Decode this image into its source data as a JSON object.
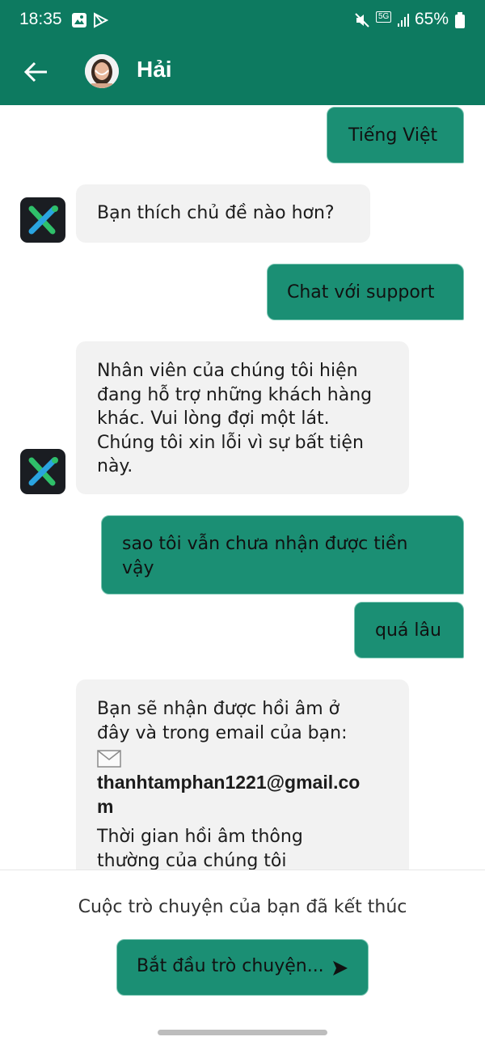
{
  "status_bar": {
    "time": "18:35",
    "battery_percent": "65%",
    "network": "5G"
  },
  "header": {
    "agent_name": "Hải"
  },
  "messages": [
    {
      "from": "user",
      "text": "Tiếng Việt"
    },
    {
      "from": "bot",
      "text": "Bạn thích chủ đề nào hơn?"
    },
    {
      "from": "user",
      "text": "Chat với support"
    },
    {
      "from": "bot",
      "lines": [
        "Nhân viên của chúng tôi hiện",
        "đang hỗ trợ những khách hàng",
        "khác. Vui lòng đợi một lát.",
        "Chúng tôi xin lỗi vì sự bất tiện",
        "này."
      ]
    },
    {
      "from": "user",
      "lines": [
        "sao tôi vẫn chưa nhận được tiền",
        "vậy"
      ]
    },
    {
      "from": "user",
      "text": "quá lâu"
    },
    {
      "from": "bot",
      "lines": [
        "Bạn sẽ nhận được hồi âm ở",
        "đây và trong email của bạn:"
      ],
      "email_lines": [
        "thanhtamphan1221@gmail.co",
        "m"
      ],
      "more_lines": [
        "Thời gian hồi âm thông",
        "thường của chúng tôi"
      ]
    }
  ],
  "footer": {
    "ended_text": "Cuộc trò chuyện của bạn đã kết thúc",
    "start_button_label": "Bắt đầu trò chuyện..."
  },
  "colors": {
    "header_bg": "#0d7a60",
    "user_bubble": "#1b8f74",
    "bot_bubble": "#f2f2f2"
  },
  "icons": [
    "back-arrow-icon",
    "envelope-icon",
    "send-icon",
    "mute-icon",
    "signal-icon",
    "battery-icon",
    "image-icon",
    "play-store-icon"
  ]
}
